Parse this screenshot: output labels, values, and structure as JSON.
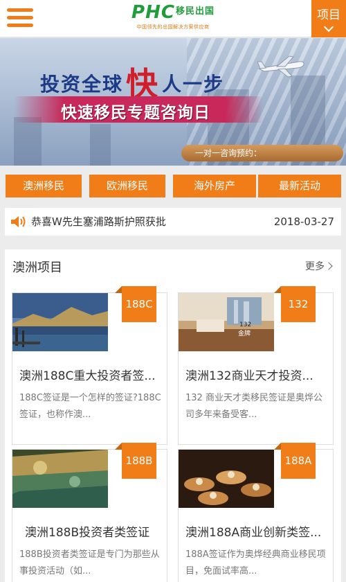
{
  "header": {
    "logo_text": "PHC",
    "logo_cn": "移民出国",
    "logo_tagline": "中国领先的出国解决方案供应商",
    "project_label": "项目",
    "accent": "#f07d17",
    "logo_color": "#1e9d3a"
  },
  "banner": {
    "title_left": "投资全球",
    "title_big": "快",
    "title_right": "人一步",
    "subtitle": "快速移民专题咨询日",
    "consult": "一对一咨询预约："
  },
  "categories": [
    "澳洲移民",
    "欧洲移民",
    "海外房产",
    "最新活动"
  ],
  "ticker": {
    "text": "恭喜W先生塞浦路斯护照获批",
    "date": "2018-03-27"
  },
  "section": {
    "title": "澳洲项目",
    "more": "更多",
    "cards": [
      {
        "badge": "188C",
        "title": "澳洲188C重大投资者签...",
        "desc": "188C签证是一个怎样的签证?188C签证，也称作澳..."
      },
      {
        "badge": "132",
        "title": "澳洲132商业天才投资...",
        "desc": "132 商业天才类移民签证是奥烨公司多年来备受客...",
        "img_text_1": "132",
        "img_text_2": "金牌"
      },
      {
        "badge": "188B",
        "title": "澳洲188B投资者类签证",
        "desc": "188B投资者类签证是专门为那些从事投资活动（如..."
      },
      {
        "badge": "188A",
        "title": "澳洲188A商业创新类签...",
        "desc": "188A签证作为奥烨经典商业移民项目，免面试率高..."
      }
    ]
  }
}
